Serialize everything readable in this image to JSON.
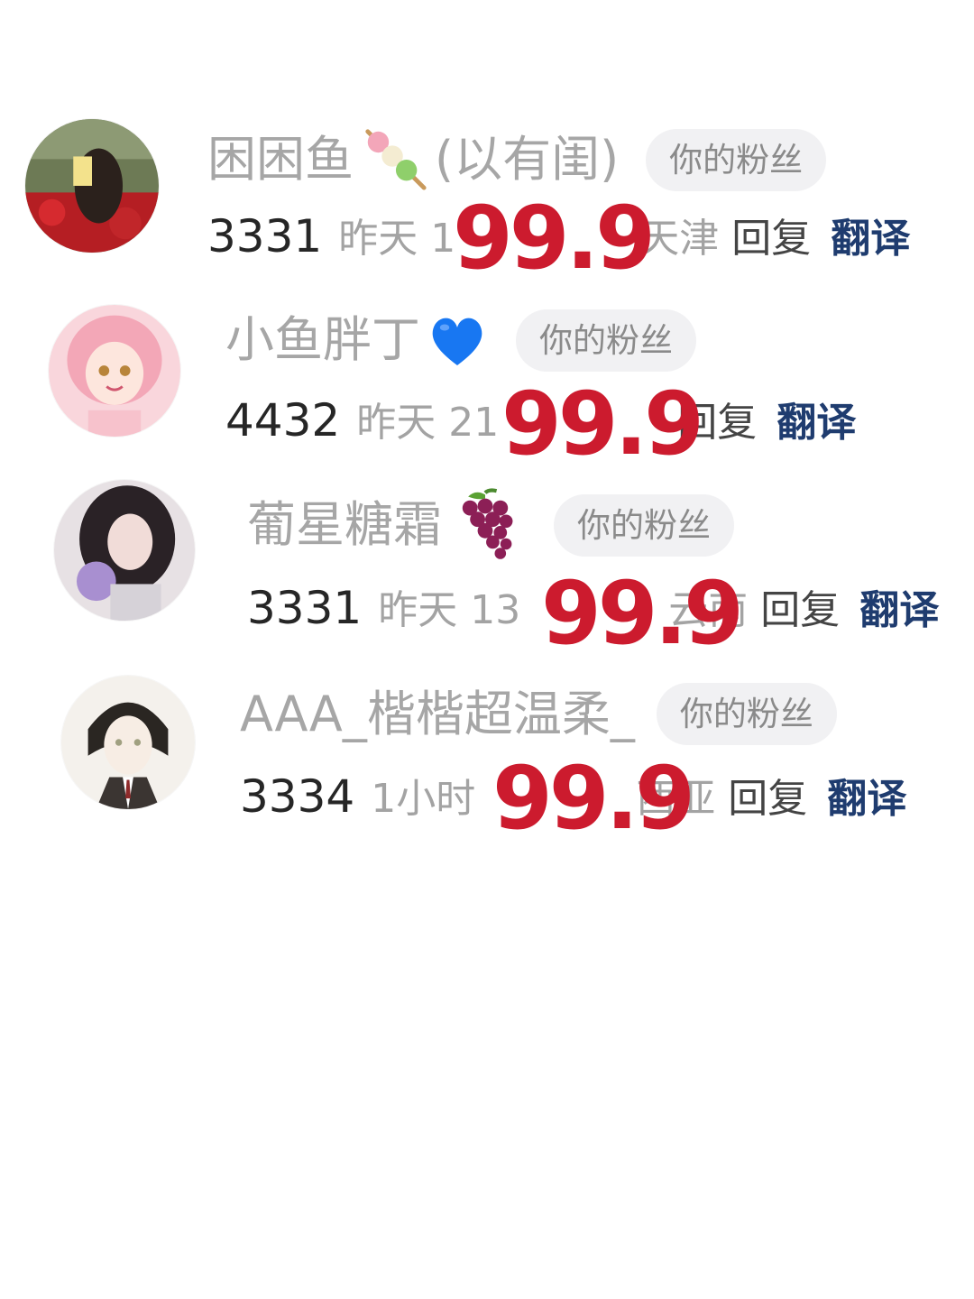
{
  "comments": [
    {
      "nickname": "困困鱼",
      "emoji": "dango-icon",
      "nick_suffix": "(以有闺)",
      "badge": "你的粉丝",
      "count": "3331",
      "date": "昨天",
      "time": "1",
      "location": "天津",
      "reply": "回复",
      "translate": "翻译",
      "overlay": "99.9"
    },
    {
      "nickname": "小鱼胖丁",
      "emoji": "blue-heart-icon",
      "nick_suffix": "",
      "badge": "你的粉丝",
      "count": "4432",
      "date": "昨天",
      "time": "21",
      "location": "",
      "reply": "回复",
      "translate": "翻译",
      "overlay": "99.9"
    },
    {
      "nickname": "葡星糖霜",
      "emoji": "grapes-icon",
      "nick_suffix": "",
      "badge": "你的粉丝",
      "count": "3331",
      "date": "昨天",
      "time": "13",
      "location": "云南",
      "reply": "回复",
      "translate": "翻译",
      "overlay": "99.9"
    },
    {
      "nickname": "AAA_楷楷超温柔_",
      "emoji": "",
      "nick_suffix": "",
      "badge": "你的粉丝",
      "count": "3334",
      "date": "1小时",
      "time": "",
      "location": "西亚",
      "reply": "回复",
      "translate": "翻译",
      "overlay": "99.9"
    }
  ],
  "colors": {
    "overlay": "#cc1b2e",
    "translate": "#1f3c6f",
    "badge_bg": "#f1f1f3"
  }
}
